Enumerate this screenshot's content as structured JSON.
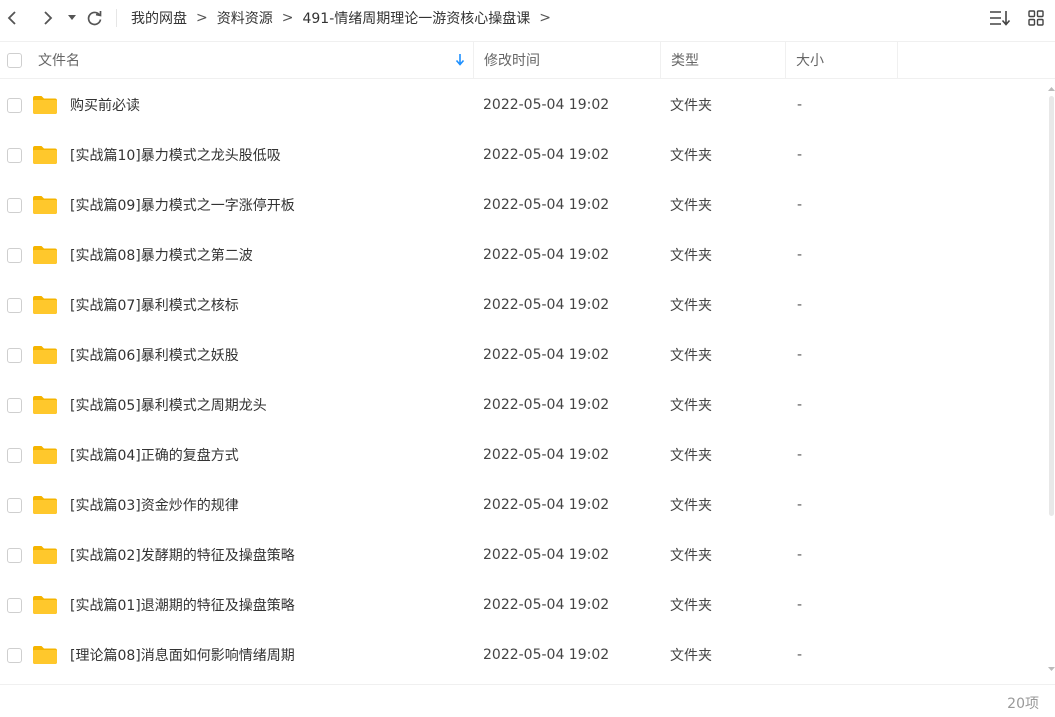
{
  "breadcrumb": [
    "我的网盘",
    "资料资源",
    "491-情绪周期理论一游资核心操盘课"
  ],
  "breadcrumb_sep": ">",
  "icons": {
    "back": "chevron-left-icon",
    "forward": "chevron-right-icon",
    "history": "caret-down-icon",
    "refresh": "refresh-icon",
    "sort": "sort-list-icon",
    "view": "grid-view-icon"
  },
  "columns": {
    "name": "文件名",
    "modified": "修改时间",
    "type": "类型",
    "size": "大小"
  },
  "files": [
    {
      "name": "购买前必读",
      "modified": "2022-05-04 19:02",
      "type": "文件夹",
      "size": "-"
    },
    {
      "name": "[实战篇10]暴力模式之龙头股低吸",
      "modified": "2022-05-04 19:02",
      "type": "文件夹",
      "size": "-"
    },
    {
      "name": "[实战篇09]暴力模式之一字涨停开板",
      "modified": "2022-05-04 19:02",
      "type": "文件夹",
      "size": "-"
    },
    {
      "name": "[实战篇08]暴力模式之第二波",
      "modified": "2022-05-04 19:02",
      "type": "文件夹",
      "size": "-"
    },
    {
      "name": "[实战篇07]暴利模式之核标",
      "modified": "2022-05-04 19:02",
      "type": "文件夹",
      "size": "-"
    },
    {
      "name": "[实战篇06]暴利模式之妖股",
      "modified": "2022-05-04 19:02",
      "type": "文件夹",
      "size": "-"
    },
    {
      "name": "[实战篇05]暴利模式之周期龙头",
      "modified": "2022-05-04 19:02",
      "type": "文件夹",
      "size": "-"
    },
    {
      "name": "[实战篇04]正确的复盘方式",
      "modified": "2022-05-04 19:02",
      "type": "文件夹",
      "size": "-"
    },
    {
      "name": "[实战篇03]资金炒作的规律",
      "modified": "2022-05-04 19:02",
      "type": "文件夹",
      "size": "-"
    },
    {
      "name": "[实战篇02]发酵期的特征及操盘策略",
      "modified": "2022-05-04 19:02",
      "type": "文件夹",
      "size": "-"
    },
    {
      "name": "[实战篇01]退潮期的特征及操盘策略",
      "modified": "2022-05-04 19:02",
      "type": "文件夹",
      "size": "-"
    },
    {
      "name": "[理论篇08]消息面如何影响情绪周期",
      "modified": "2022-05-04 19:02",
      "type": "文件夹",
      "size": "-"
    }
  ],
  "footer": {
    "count": "20项"
  },
  "colors": {
    "folder": "#FFC82C",
    "folder_dark": "#F5B400",
    "sort_arrow": "#1E90FF"
  }
}
